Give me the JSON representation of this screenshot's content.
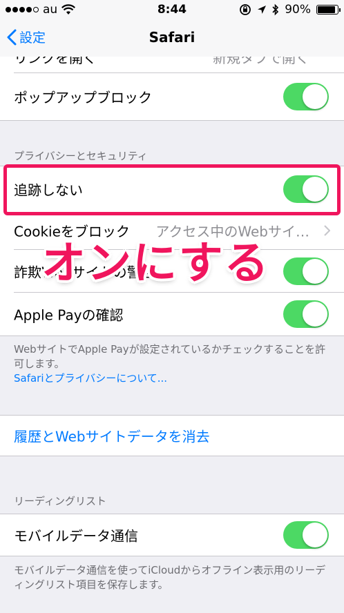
{
  "status_bar": {
    "carrier": "au",
    "time": "8:44",
    "battery_percent": "90%",
    "battery_level": 0.9,
    "icons": [
      "signal-dots",
      "wifi-icon",
      "rotation-lock-icon",
      "location-icon",
      "bluetooth-icon",
      "battery-icon"
    ]
  },
  "nav": {
    "back_label": "設定",
    "title": "Safari"
  },
  "partial_row": {
    "label": "リンクを開く",
    "value": "新規タブで開く"
  },
  "popup_block": {
    "label": "ポップアップブロック",
    "on": true
  },
  "privacy_section": {
    "header": "プライバシーとセキュリティ",
    "rows": [
      {
        "label": "追跡しない",
        "on": true
      },
      {
        "label": "Cookieをブロック",
        "value": "アクセス中のWebサイ…"
      },
      {
        "label": "詐欺Webサイトの警告",
        "on": true
      },
      {
        "label": "Apple Payの確認",
        "on": true
      }
    ],
    "footer": "WebサイトでApple Payが設定されているかチェックすることを許可します。",
    "footer_link": "Safariとプライバシーについて..."
  },
  "clear_history": {
    "label": "履歴とWebサイトデータを消去"
  },
  "reading_list_section": {
    "header": "リーディングリスト",
    "row": {
      "label": "モバイルデータ通信",
      "on": true
    },
    "footer": "モバイルデータ通信を使ってiCloudからオフライン表示用のリーディングリスト項目を保存します。"
  },
  "annotation": {
    "text": "オンにする"
  },
  "colors": {
    "accent": "#007aff",
    "toggle_on": "#4cd964",
    "highlight": "#f0155d",
    "background": "#efeff4"
  }
}
